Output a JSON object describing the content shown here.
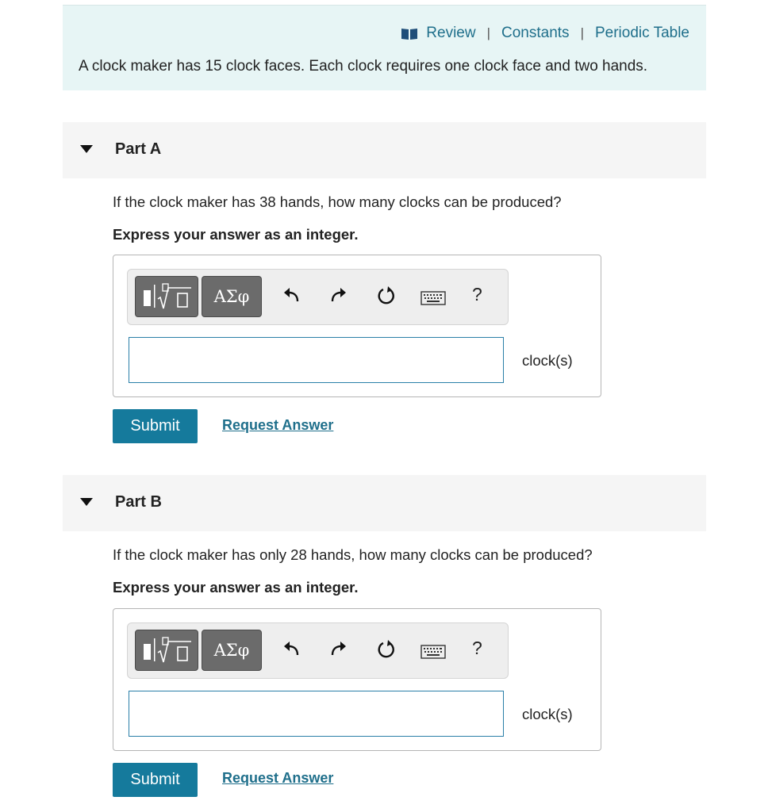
{
  "header": {
    "links": [
      "Review",
      "Constants",
      "Periodic Table"
    ],
    "separator": "|",
    "problem_text": "A clock maker has 15 clock faces. Each clock requires one clock face and two hands."
  },
  "toolbar": {
    "greek_label": "ΑΣφ",
    "help_label": "?"
  },
  "parts": [
    {
      "title": "Part A",
      "question": "If the clock maker has 38 hands, how many clocks can be produced?",
      "instruction": "Express your answer as an integer.",
      "answer_value": "",
      "unit": "clock(s)",
      "submit_label": "Submit",
      "request_label": "Request Answer"
    },
    {
      "title": "Part B",
      "question": "If the clock maker has only 28 hands, how many clocks can be produced?",
      "instruction": "Express your answer as an integer.",
      "answer_value": "",
      "unit": "clock(s)",
      "submit_label": "Submit",
      "request_label": "Request Answer"
    }
  ],
  "colors": {
    "intro_bg": "#e7f5f5",
    "link": "#1f6f8b",
    "submit_bg": "#157a9c",
    "toolbar_button": "#6b6b6b"
  }
}
